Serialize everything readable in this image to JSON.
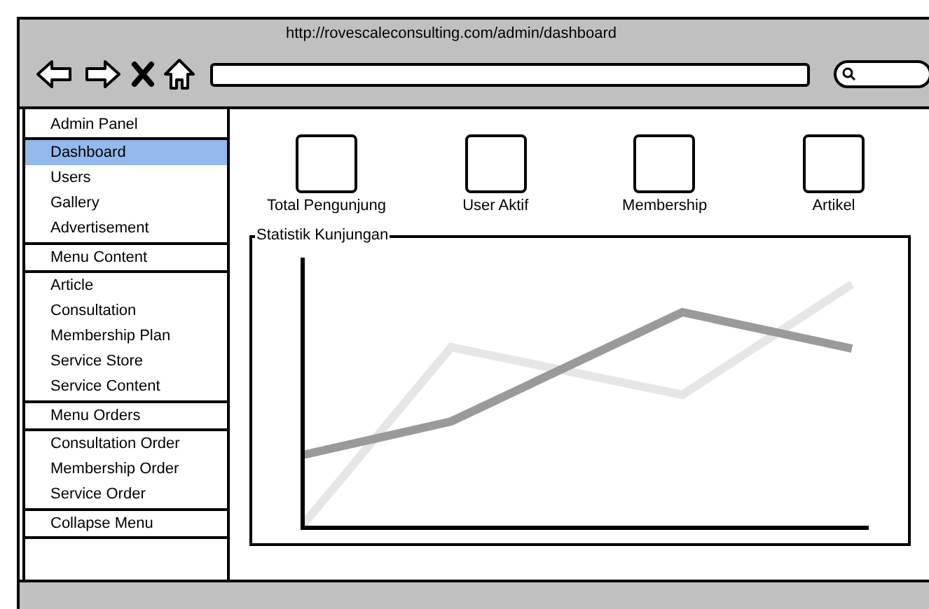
{
  "browser": {
    "url": "http://rovescaleconsulting.com/admin/dashboard"
  },
  "sidebar": {
    "items": [
      {
        "kind": "header",
        "label": "Admin Panel",
        "selected": false
      },
      {
        "kind": "link",
        "label": "Dashboard",
        "selected": true
      },
      {
        "kind": "link",
        "label": "Users",
        "selected": false
      },
      {
        "kind": "link",
        "label": "Gallery",
        "selected": false
      },
      {
        "kind": "link",
        "label": "Advertisement",
        "selected": false
      },
      {
        "kind": "header",
        "label": "Menu Content",
        "selected": false
      },
      {
        "kind": "link",
        "label": "Article",
        "selected": false
      },
      {
        "kind": "link",
        "label": "Consultation",
        "selected": false
      },
      {
        "kind": "link",
        "label": "Membership Plan",
        "selected": false
      },
      {
        "kind": "link",
        "label": "Service Store",
        "selected": false
      },
      {
        "kind": "link",
        "label": "Service Content",
        "selected": false
      },
      {
        "kind": "header",
        "label": "Menu Orders",
        "selected": false
      },
      {
        "kind": "link",
        "label": "Consultation Order",
        "selected": false
      },
      {
        "kind": "link",
        "label": "Membership Order",
        "selected": false
      },
      {
        "kind": "link",
        "label": "Service Order",
        "selected": false
      },
      {
        "kind": "header",
        "label": "Collapse Menu",
        "selected": false
      }
    ]
  },
  "stats": [
    {
      "label": "Total Pengunjung"
    },
    {
      "label": "User Aktif"
    },
    {
      "label": "Membership"
    },
    {
      "label": "Artikel"
    }
  ],
  "chart": {
    "title": "Statistik Kunjungan"
  }
}
